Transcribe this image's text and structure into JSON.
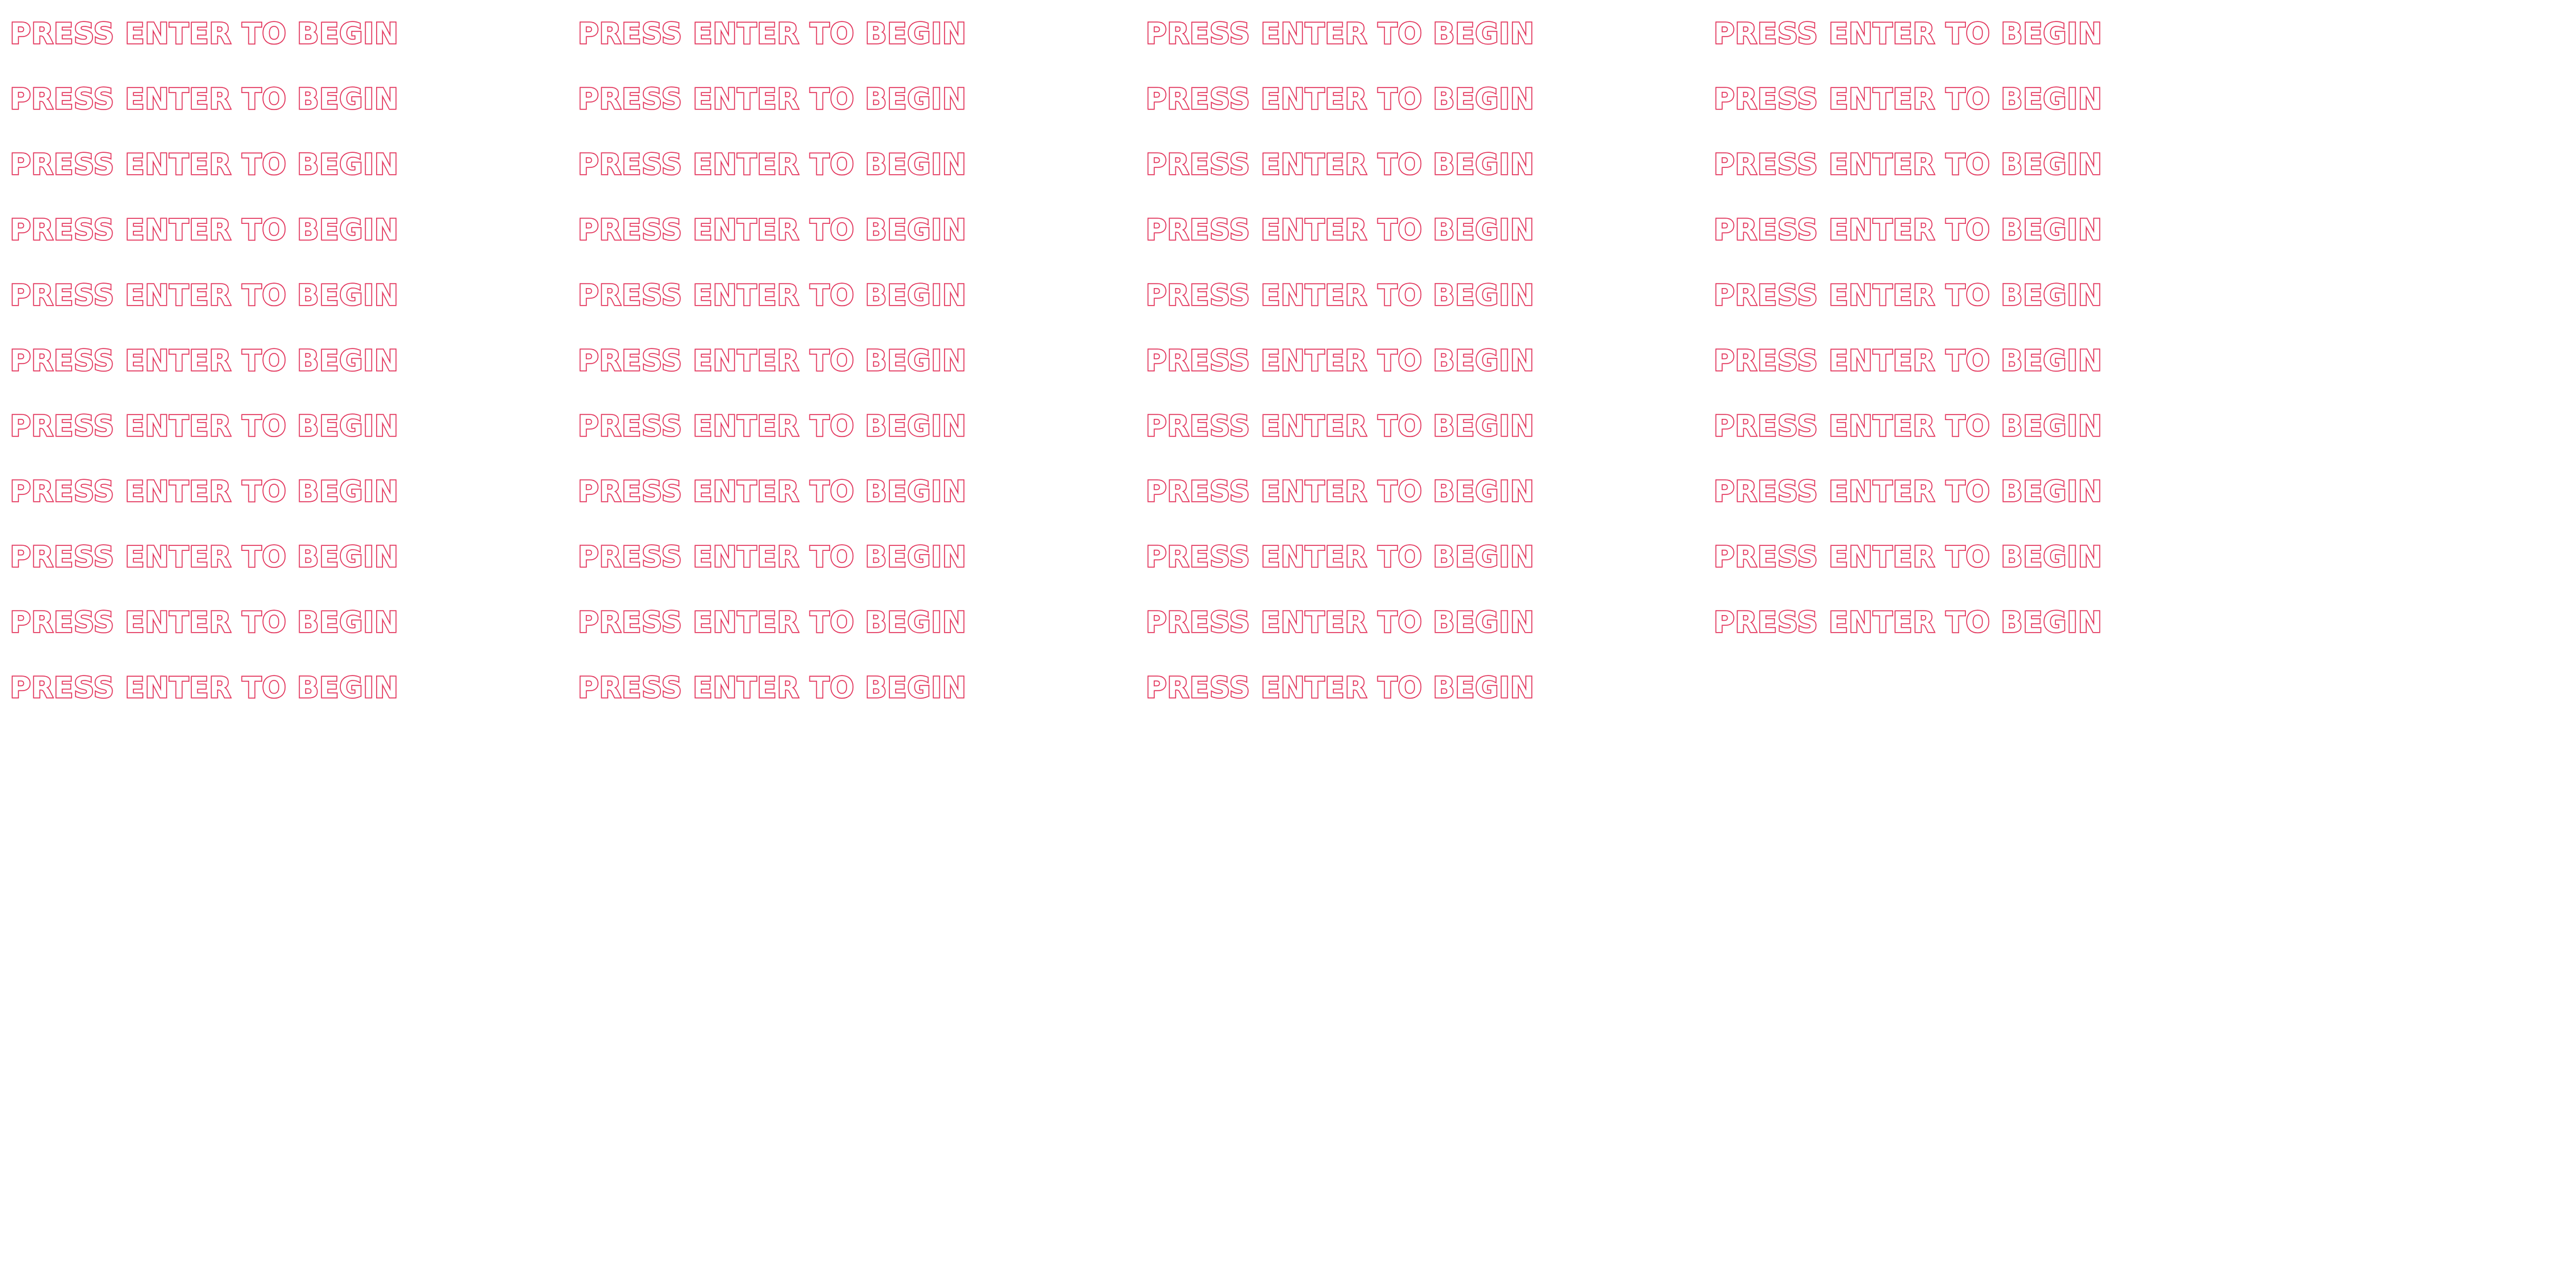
{
  "sprite_sheet": {
    "prompt_text": "PRESS ENTER TO BEGIN",
    "frame_count": 43,
    "columns": 4,
    "colors": {
      "outline": "#e8335a",
      "fill": "#ffffff",
      "background": "#ffffff"
    }
  }
}
